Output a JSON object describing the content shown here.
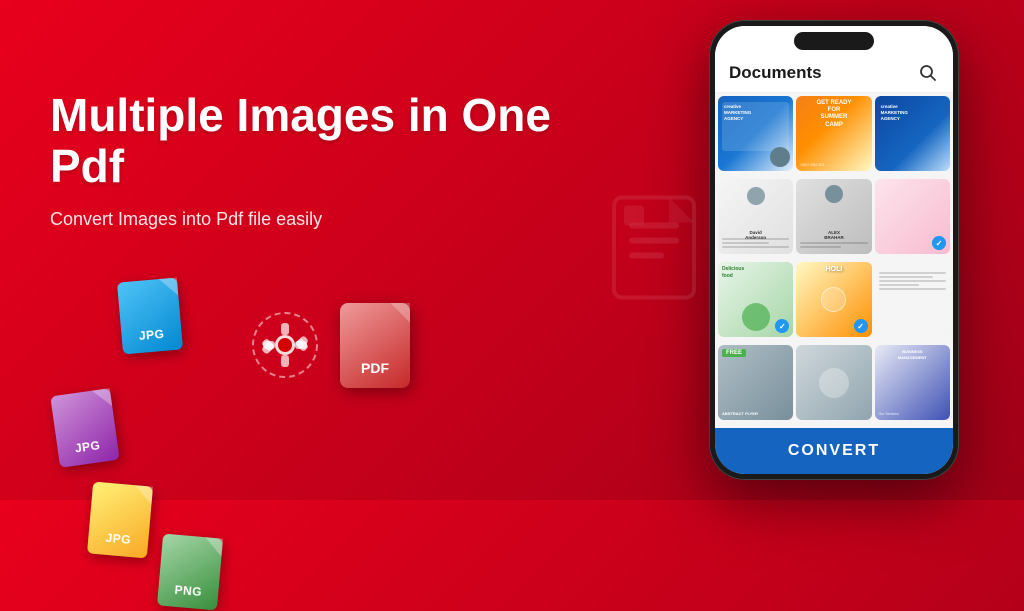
{
  "app": {
    "title": "Multiple Images in One Pdf",
    "subtitle": "Convert Images into Pdf file easily",
    "bg_color": "#d50000",
    "accent_color": "#1565c0"
  },
  "icons": {
    "jpg_label": "JPG",
    "png_label": "PNG",
    "pdf_label": "PDF",
    "gear_label": "gear",
    "search_label": "search"
  },
  "phone": {
    "header_title": "Documents",
    "convert_button": "CONVERT",
    "grid_items": [
      {
        "id": 1,
        "type": "marketing",
        "checked": false,
        "label": "creative MARKETING AGENCY"
      },
      {
        "id": 2,
        "type": "camp",
        "checked": false,
        "label": "SUMMER CAMP"
      },
      {
        "id": 3,
        "type": "marketing2",
        "checked": false,
        "label": "creative MARKETING AGENCY"
      },
      {
        "id": 4,
        "type": "resume",
        "checked": false,
        "label": "David Anderson"
      },
      {
        "id": 5,
        "type": "resume2",
        "checked": false,
        "label": "ALEX BRAHAR"
      },
      {
        "id": 6,
        "type": "people",
        "checked": true,
        "label": ""
      },
      {
        "id": 7,
        "type": "food",
        "checked": true,
        "label": "Delicious food"
      },
      {
        "id": 8,
        "type": "holi",
        "checked": true,
        "label": "HOLI"
      },
      {
        "id": 9,
        "type": "document",
        "checked": false,
        "label": ""
      },
      {
        "id": 10,
        "type": "abstract",
        "checked": false,
        "label": "ABSTRACT FLYER",
        "badge": "FREE"
      },
      {
        "id": 11,
        "type": "flyer2",
        "checked": false,
        "label": ""
      },
      {
        "id": 12,
        "type": "business",
        "checked": false,
        "label": "BUSINESS MANAGEMENT"
      }
    ]
  }
}
